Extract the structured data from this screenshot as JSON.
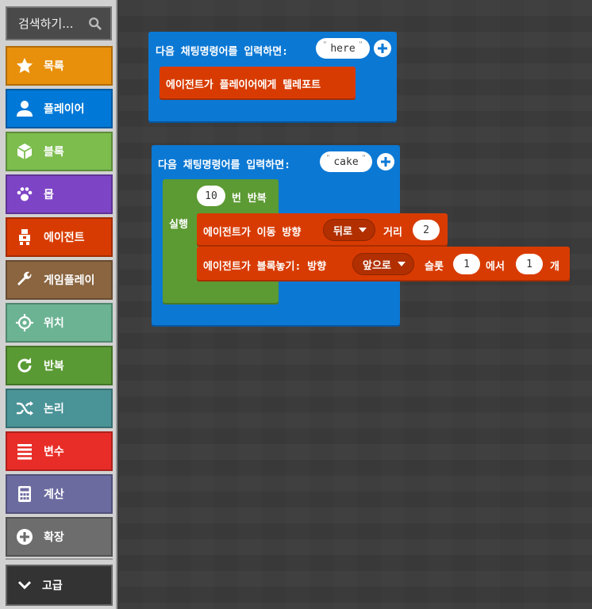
{
  "toolbox": {
    "search_label": "검색하기...",
    "categories": [
      {
        "label": "목록",
        "icon": "star-icon",
        "color": "#e8900c"
      },
      {
        "label": "플레이어",
        "icon": "person-icon",
        "color": "#0078d7"
      },
      {
        "label": "블록",
        "icon": "cube-icon",
        "color": "#7cbd4e"
      },
      {
        "label": "몹",
        "icon": "paw-icon",
        "color": "#7e44c6"
      },
      {
        "label": "에이전트",
        "icon": "robot-icon",
        "color": "#d83b01"
      },
      {
        "label": "게임플레이",
        "icon": "wrench-icon",
        "color": "#8a6540"
      },
      {
        "label": "위치",
        "icon": "crosshair-icon",
        "color": "#6bb393"
      },
      {
        "label": "반복",
        "icon": "refresh-icon",
        "color": "#5a9a34"
      },
      {
        "label": "논리",
        "icon": "shuffle-icon",
        "color": "#4a9397"
      },
      {
        "label": "변수",
        "icon": "list-icon",
        "color": "#e82c27"
      },
      {
        "label": "계산",
        "icon": "calculator-icon",
        "color": "#6c6ba0"
      },
      {
        "label": "확장",
        "icon": "plus-circle-icon",
        "color": "#6d6d6d"
      }
    ],
    "advanced_label": "고급"
  },
  "blocks": {
    "cmd1": {
      "label": "다음 채팅명령어를 입력하면:",
      "command": "here",
      "inner": "에이전트가 플레이어에게 텔레포트"
    },
    "cmd2": {
      "label": "다음 채팅명령어를 입력하면:",
      "command": "cake",
      "repeat_count": "10",
      "repeat_label": "번 반복",
      "do_label": "실행",
      "move": {
        "prefix": "에이전트가 이동 방향",
        "direction": "뒤로",
        "distance_label": "거리",
        "distance": "2"
      },
      "place": {
        "prefix": "에이전트가 블록놓기: 방향",
        "direction": "앞으로",
        "slot_label": "슬롯",
        "slot": "1",
        "count_label": "에서",
        "count": "1",
        "suffix": "개"
      }
    }
  },
  "colors": {
    "player_blue": "#0b78d4",
    "agent_red": "#d83b01",
    "loop_green": "#5c9a33"
  }
}
